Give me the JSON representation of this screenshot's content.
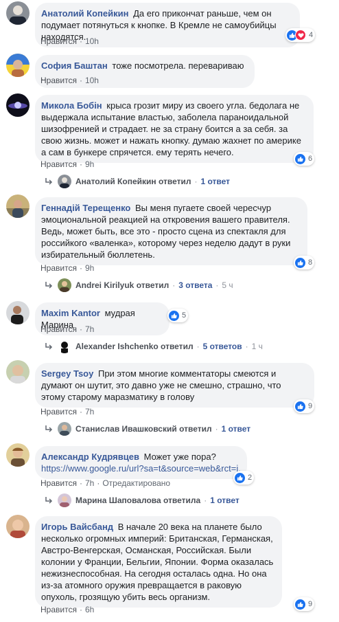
{
  "comments": [
    {
      "author": "Анатолий Копейкин",
      "text": "Да его прикончат раньше, чем он подумает потянуться к кнопке. В Кремле не самоубийцы находятся.",
      "like_label": "Нравится",
      "time": "10h",
      "reactions": "4"
    },
    {
      "author": "София Баштан",
      "text": "тоже посмотрела. перевариваю ...",
      "like_label": "Нравится",
      "time": "10h"
    },
    {
      "author": "Микола Бобін",
      "text": "крыса грозит миру из своего угла. бедолага не выдержала испытание властью, заболела параноидальной шизофренией и страдает. не за страну боится а за себя. за свою жизнь. может и нажать кнопку. думаю жахнет по америке а сам в бункере спрячется. ему терять нечего.",
      "like_label": "Нравится",
      "time": "9h",
      "reactions": "6",
      "reply": {
        "name": "Анатолий Копейкин ответил",
        "count": "1 ответ"
      }
    },
    {
      "author": "Геннадій Терещенко",
      "text": "Вы меня пугаете своей чересчур эмоциональной реакцией на откровения вашего правителя. Ведь, может быть, все это - просто сцена из спектакля для российкого «валенка», которому через неделю дадут в руки избирательный бюллетень.",
      "like_label": "Нравится",
      "time": "9h",
      "reactions": "8",
      "reply": {
        "name": "Andrei Kirilyuk ответил",
        "count": "3 ответа",
        "time": "5 ч"
      }
    },
    {
      "author": "Maxim Kantor",
      "text": "мудрая Марина",
      "like_label": "Нравится",
      "time": "7h",
      "reactions": "5",
      "reply": {
        "name": "Alexander Ishchenko ответил",
        "count": "5 ответов",
        "time": "1 ч"
      }
    },
    {
      "author": "Sergey Tsoy",
      "text": "При этом многие комментаторы смеются и думают он шутит, это давно уже не смешно, страшно, что этому старому маразматику в голову",
      "like_label": "Нравится",
      "time": "7h",
      "reactions": "9",
      "reply": {
        "name": "Станислав Ивашковский ответил",
        "count": "1 ответ"
      }
    },
    {
      "author": "Александр Кудрявцев",
      "text": "Может уже пора?",
      "link": "https://www.google.ru/url?sa=t&source=web&rct=j...",
      "like_label": "Нравится",
      "time": "7h",
      "edited": "Отредактировано",
      "reactions": "2",
      "reply": {
        "name": "Марина Шаповалова ответила",
        "count": "1 ответ"
      }
    },
    {
      "author": "Игорь Вайсбанд",
      "text": "В начале 20 века на планете было несколько огромных империй: Британская, Германская, Австро-Венгерская, Османская, Российская. Были колонии у Франции, Бельгии, Японии. Форма оказалась нежизнеспособная. На сегодня осталась одна. Но она из-за атомного оружия превращается в раковую опухоль, грозящую убить весь организм.",
      "like_label": "Нравится",
      "time": "6h",
      "reactions": "9"
    }
  ],
  "colors": {
    "link": "#385898",
    "bubble": "#f2f3f5",
    "like": "#1a72f0",
    "love": "#f0284a"
  },
  "icons": [
    "like-icon",
    "love-icon",
    "reply-arrow-icon",
    "avatar"
  ]
}
